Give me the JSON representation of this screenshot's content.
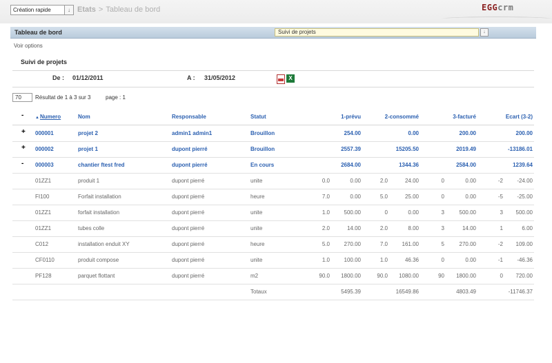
{
  "topbar": {
    "quick_create": "Création rapide",
    "crumb_section": "Etats",
    "crumb_sep": ">",
    "crumb_page": "Tableau de bord",
    "logo_egg": "EGG",
    "logo_crm": "crm"
  },
  "panel": {
    "title": "Tableau de bord",
    "report_select": "Suivi de projets"
  },
  "voir_options": "Voir options",
  "section_title": "Suivi de projets",
  "period": {
    "de_label": "De :",
    "de_value": "01/12/2011",
    "a_label": "A :",
    "a_value": "31/05/2012"
  },
  "paging": {
    "per_page": "70",
    "result": "Résultat de 1 à 3 sur 3",
    "page": "page : 1"
  },
  "table": {
    "headers": {
      "toggle": "-",
      "numero": "Numero",
      "nom": "Nom",
      "responsable": "Responsable",
      "statut": "Statut",
      "prevu": "1-prévu",
      "consomme": "2-consommé",
      "facture": "3-facturé",
      "ecart": "Ecart (3-2)"
    },
    "projects": [
      {
        "toggle": "+",
        "numero": "000001",
        "nom": "projet 2",
        "responsable": "admin1 admin1",
        "statut": "Brouillon",
        "prevu": "254.00",
        "consomme": "0.00",
        "facture": "200.00",
        "ecart": "200.00"
      },
      {
        "toggle": "+",
        "numero": "000002",
        "nom": "projet 1",
        "responsable": "dupont pierré",
        "statut": "Brouillon",
        "prevu": "2557.39",
        "consomme": "15205.50",
        "facture": "2019.49",
        "ecart": "-13186.01"
      },
      {
        "toggle": "-",
        "numero": "000003",
        "nom": "chantier ftest fred",
        "responsable": "dupont pierré",
        "statut": "En cours",
        "prevu": "2684.00",
        "consomme": "1344.36",
        "facture": "2584.00",
        "ecart": "1239.64"
      }
    ],
    "lines": [
      {
        "code": "01ZZ1",
        "nom": "produit 1",
        "responsable": "dupont pierré",
        "unite": "unite",
        "q1": "0.0",
        "v1": "0.00",
        "q2": "2.0",
        "v2": "24.00",
        "q3": "0",
        "v3": "0.00",
        "q4": "-2",
        "v4": "-24.00"
      },
      {
        "code": "FI100",
        "nom": "Forfait installation",
        "responsable": "dupont pierré",
        "unite": "heure",
        "q1": "7.0",
        "v1": "0.00",
        "q2": "5.0",
        "v2": "25.00",
        "q3": "0",
        "v3": "0.00",
        "q4": "-5",
        "v4": "-25.00"
      },
      {
        "code": "01ZZ1",
        "nom": "forfait installation",
        "responsable": "dupont pierré",
        "unite": "unite",
        "q1": "1.0",
        "v1": "500.00",
        "q2": "0",
        "v2": "0.00",
        "q3": "3",
        "v3": "500.00",
        "q4": "3",
        "v4": "500.00"
      },
      {
        "code": "01ZZ1",
        "nom": "tubes colle",
        "responsable": "dupont pierré",
        "unite": "unite",
        "q1": "2.0",
        "v1": "14.00",
        "q2": "2.0",
        "v2": "8.00",
        "q3": "3",
        "v3": "14.00",
        "q4": "1",
        "v4": "6.00"
      },
      {
        "code": "C012",
        "nom": "installation enduit XY",
        "responsable": "dupont pierré",
        "unite": "heure",
        "q1": "5.0",
        "v1": "270.00",
        "q2": "7.0",
        "v2": "161.00",
        "q3": "5",
        "v3": "270.00",
        "q4": "-2",
        "v4": "109.00"
      },
      {
        "code": "CF0110",
        "nom": "produit compose",
        "responsable": "dupont pierré",
        "unite": "unite",
        "q1": "1.0",
        "v1": "100.00",
        "q2": "1.0",
        "v2": "46.36",
        "q3": "0",
        "v3": "0.00",
        "q4": "-1",
        "v4": "-46.36"
      },
      {
        "code": "PF128",
        "nom": "parquet flottant",
        "responsable": "dupont pierré",
        "unite": "m2",
        "q1": "90.0",
        "v1": "1800.00",
        "q2": "90.0",
        "v2": "1080.00",
        "q3": "90",
        "v3": "1800.00",
        "q4": "0",
        "v4": "720.00"
      }
    ],
    "totals": {
      "label": "Totaux",
      "prevu": "5495.39",
      "consomme": "16549.86",
      "facture": "4803.49",
      "ecart": "-11746.37"
    }
  }
}
